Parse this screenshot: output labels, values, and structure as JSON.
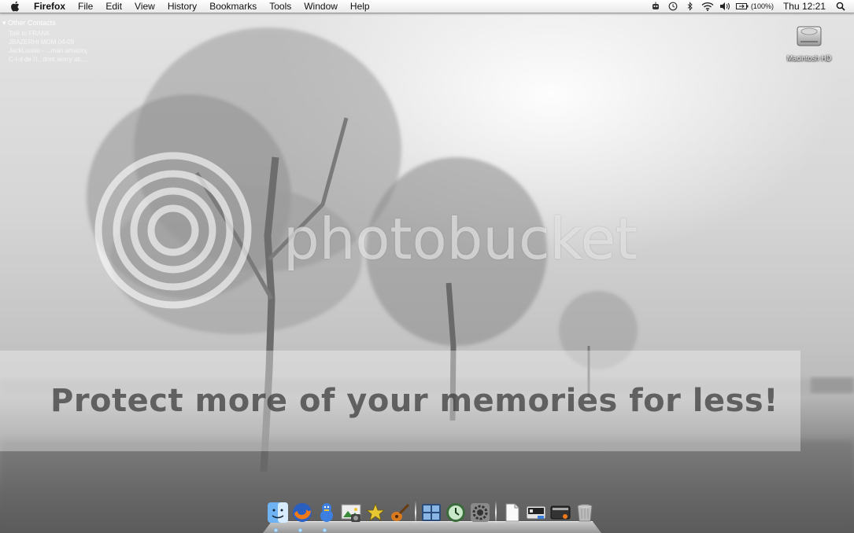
{
  "menubar": {
    "app_name": "Firefox",
    "menus": [
      "File",
      "Edit",
      "View",
      "History",
      "Bookmarks",
      "Tools",
      "Window",
      "Help"
    ],
    "battery_text": "(100%)",
    "clock": "Thu 12:21"
  },
  "contacts": {
    "group_label": "Other Contacts",
    "items": [
      "Talk to FRANK",
      "JBAZERHI MOM 04-09",
      "JackLouise - ...man amazing...",
      "C-I-d de l'I...dont worry ab..."
    ]
  },
  "desktop": {
    "drive_label": "Macintosh HD"
  },
  "watermark": {
    "brand": "photobucket",
    "banner": "Protect more of your memories for less!"
  },
  "dock": {
    "apps": [
      "finder-icon",
      "firefox-icon",
      "adium-icon",
      "iphoto-icon",
      "imovie-icon",
      "garageband-icon",
      "spaces-icon",
      "time-machine-icon",
      "system-preferences-icon"
    ],
    "docs": [
      "documents-stack-icon",
      "downloads-stack-icon",
      "application-stack-icon",
      "trash-icon"
    ]
  },
  "colors": {
    "menubar": "#ececec",
    "dock_indicator": "#4aa3ff"
  }
}
